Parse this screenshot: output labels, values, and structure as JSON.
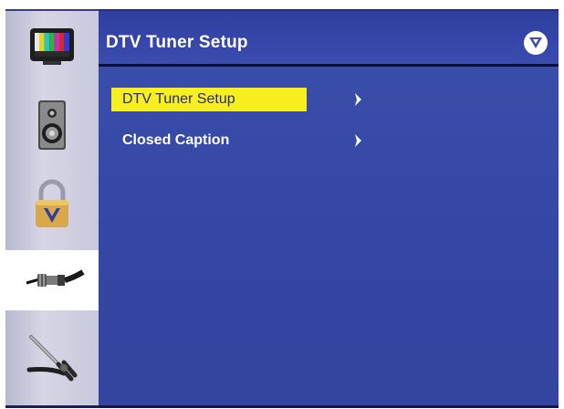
{
  "header": {
    "title": "DTV Tuner Setup",
    "logo_icon": "v-logo-icon"
  },
  "sidebar": {
    "items": [
      {
        "icon": "tv-color-bars-icon",
        "selected": false
      },
      {
        "icon": "speaker-icon",
        "selected": false
      },
      {
        "icon": "lock-icon",
        "selected": false
      },
      {
        "icon": "coax-cable-icon",
        "selected": true
      },
      {
        "icon": "tools-icon",
        "selected": false
      }
    ]
  },
  "menu": {
    "items": [
      {
        "label": "DTV Tuner Setup",
        "selected": true,
        "arrow_icon": "chevron-right-icon"
      },
      {
        "label": "Closed Caption",
        "selected": false,
        "arrow_icon": "chevron-right-icon"
      }
    ]
  },
  "colors": {
    "panel_blue": "#3a4fab",
    "highlight_yellow": "#f7ef1f",
    "highlight_text": "#2a2a88",
    "sidebar_gray": "#c9c9dd",
    "text_white": "#ffffff"
  }
}
